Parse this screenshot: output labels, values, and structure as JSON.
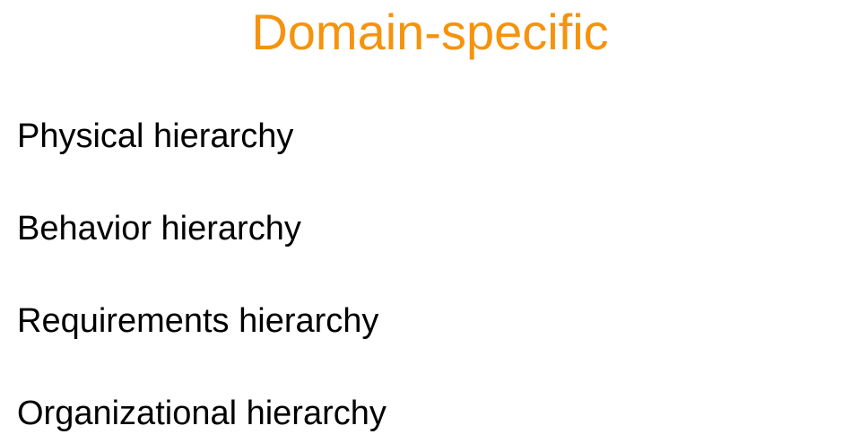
{
  "slide": {
    "title": "Domain-specific",
    "items": [
      {
        "label": "Physical hierarchy"
      },
      {
        "label": "Behavior hierarchy"
      },
      {
        "label": "Requirements hierarchy"
      },
      {
        "label": "Organizational hierarchy"
      }
    ]
  },
  "colors": {
    "title": "#f5930c",
    "text": "#000000",
    "background": "#ffffff"
  }
}
